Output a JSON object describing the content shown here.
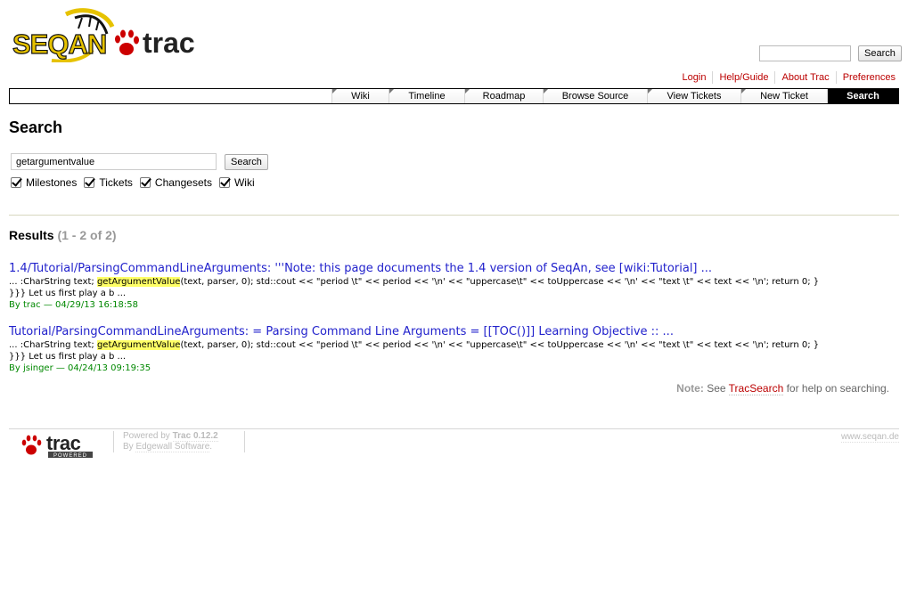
{
  "header": {
    "logo_text_seqan": "SEQAN",
    "logo_text_trac": "trac",
    "search": {
      "value": "",
      "button": "Search"
    }
  },
  "metanav": [
    "Login",
    "Help/Guide",
    "About Trac",
    "Preferences"
  ],
  "mainnav": [
    {
      "label": "Wiki",
      "active": false
    },
    {
      "label": "Timeline",
      "active": false
    },
    {
      "label": "Roadmap",
      "active": false
    },
    {
      "label": "Browse Source",
      "active": false
    },
    {
      "label": "View Tickets",
      "active": false
    },
    {
      "label": "New Ticket",
      "active": false
    },
    {
      "label": "Search",
      "active": true
    }
  ],
  "page": {
    "title": "Search",
    "query": "getargumentvalue",
    "search_button": "Search",
    "filters": [
      {
        "label": "Milestones",
        "checked": true
      },
      {
        "label": "Tickets",
        "checked": true
      },
      {
        "label": "Changesets",
        "checked": true
      },
      {
        "label": "Wiki",
        "checked": true
      }
    ]
  },
  "results": {
    "heading": "Results",
    "range": "(1 - 2 of 2)",
    "items": [
      {
        "title": "1.4/Tutorial/ParsingCommandLineArguments: '''Note: this page documents the 1.4 version of SeqAn, see [wiki:Tutorial] ...",
        "excerpt_before": "... :CharString text; ",
        "highlight": "getArgumentValue",
        "excerpt_after": "(text, parser, 0); std::cout << \"period \\t\" << period << '\\n' << \"uppercase\\t\" << toUppercase << '\\n' << \"text \\t\" << text << '\\n'; return 0; }",
        "excerpt_line2": "}}} Let us first play a b ...",
        "author": "trac",
        "date": "04/29/13 16:18:58"
      },
      {
        "title": "Tutorial/ParsingCommandLineArguments: = Parsing Command Line Arguments = [[TOC()]] Learning Objective :: ...",
        "excerpt_before": "... :CharString text; ",
        "highlight": "getArgumentValue",
        "excerpt_after": "(text, parser, 0); std::cout << \"period \\t\" << period << '\\n' << \"uppercase\\t\" << toUppercase << '\\n' << \"text \\t\" << text << '\\n'; return 0; }",
        "excerpt_line2": "}}} Let us first play a b ...",
        "author": "jsinger",
        "date": "04/24/13 09:19:35"
      }
    ]
  },
  "note": {
    "label": "Note:",
    "before": "See",
    "link": "TracSearch",
    "after": "for help on searching."
  },
  "footer": {
    "logo_text": "trac",
    "logo_sub": "POWERED",
    "powered_by": "Powered by",
    "version": "Trac 0.12.2",
    "by": "By",
    "company": "Edgewall Software",
    "site": "www.seqan.de"
  },
  "colors": {
    "link": "#2222cc",
    "accent": "#bb0000",
    "meta": "#008800",
    "highlight": "#ffff66"
  }
}
